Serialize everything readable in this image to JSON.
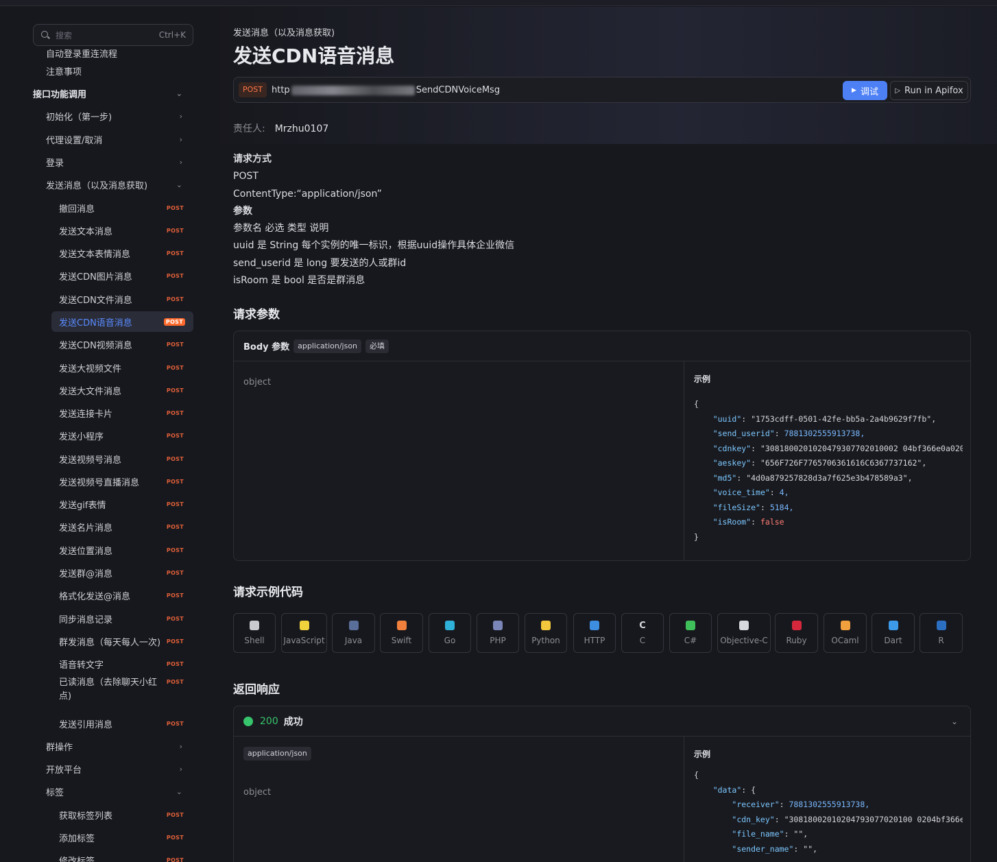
{
  "search": {
    "placeholder": "搜索",
    "shortcut": "Ctrl+K"
  },
  "sidebar": {
    "items": [
      {
        "label": "自动登录重连流程",
        "kind": "leaf-partial"
      },
      {
        "label": "注意事项",
        "kind": "leaf"
      },
      {
        "label": "接口功能调用",
        "kind": "group",
        "chevron": "⌄"
      },
      {
        "label": "初始化（第一步)",
        "kind": "folder",
        "chevron": "›"
      },
      {
        "label": "代理设置/取消",
        "kind": "folder",
        "chevron": "›"
      },
      {
        "label": "登录",
        "kind": "folder",
        "chevron": "›"
      },
      {
        "label": "发送消息（以及消息获取)",
        "kind": "folder",
        "chevron": "⌄"
      },
      {
        "label": "撤回消息",
        "badge": "POST"
      },
      {
        "label": "发送文本消息",
        "badge": "POST"
      },
      {
        "label": "发送文本表情消息",
        "badge": "POST"
      },
      {
        "label": "发送CDN图片消息",
        "badge": "POST"
      },
      {
        "label": "发送CDN文件消息",
        "badge": "POST"
      },
      {
        "label": "发送CDN语音消息",
        "badge": "POST",
        "active": true
      },
      {
        "label": "发送CDN视频消息",
        "badge": "POST"
      },
      {
        "label": "发送大视频文件",
        "badge": "POST"
      },
      {
        "label": "发送大文件消息",
        "badge": "POST"
      },
      {
        "label": "发送连接卡片",
        "badge": "POST"
      },
      {
        "label": "发送小程序",
        "badge": "POST"
      },
      {
        "label": "发送视频号消息",
        "badge": "POST"
      },
      {
        "label": "发送视频号直播消息",
        "badge": "POST"
      },
      {
        "label": "发送gif表情",
        "badge": "POST"
      },
      {
        "label": "发送名片消息",
        "badge": "POST"
      },
      {
        "label": "发送位置消息",
        "badge": "POST"
      },
      {
        "label": "发送群@消息",
        "badge": "POST"
      },
      {
        "label": "格式化发送@消息",
        "badge": "POST"
      },
      {
        "label": "同步消息记录",
        "badge": "POST"
      },
      {
        "label": "群发消息（每天每人一次)",
        "badge": "POST"
      },
      {
        "label": "语音转文字",
        "badge": "POST"
      },
      {
        "label": "已读消息（去除聊天小红",
        "label2": "点)",
        "badge": "POST"
      },
      {
        "label": "发送引用消息",
        "badge": "POST"
      },
      {
        "label": "群操作",
        "kind": "folder",
        "chevron": "›"
      },
      {
        "label": "开放平台",
        "kind": "folder",
        "chevron": "›"
      },
      {
        "label": "标签",
        "kind": "folder",
        "chevron": "⌄"
      },
      {
        "label": "获取标签列表",
        "badge": "POST"
      },
      {
        "label": "添加标签",
        "badge": "POST"
      },
      {
        "label": "修改标签",
        "badge": "POST"
      }
    ]
  },
  "page": {
    "breadcrumb": "发送消息（以及消息获取)",
    "title": "发送CDN语音消息",
    "method": "POST",
    "url_prefix": "http",
    "url_suffix": "SendCDNVoiceMsg",
    "debug_label": "调试",
    "apifox_label": "Run in Apifox",
    "owner_key": "责任人:",
    "owner_value": "Mrzhu0107"
  },
  "description": [
    {
      "text": "请求方式",
      "bold": true
    },
    {
      "text": "POST"
    },
    {
      "text": "ContentType:“application/json”"
    },
    {
      "text": "参数",
      "bold": true
    },
    {
      "text": "参数名 必选 类型 说明"
    },
    {
      "text": "uuid 是 String 每个实例的唯一标识，根据uuid操作具体企业微信"
    },
    {
      "text": "send_userid 是 long 要发送的人或群id"
    },
    {
      "text": "isRoom 是 bool 是否是群消息"
    }
  ],
  "request": {
    "section_title": "请求参数",
    "body_label": "Body 参数",
    "content_type": "application/json",
    "required": "必填",
    "object_label": "object",
    "example_label": "示例",
    "example_lines": [
      "{",
      "    \"uuid\": \"1753cdff-0501-42fe-bb5a-2a4b9629f7fb\",",
      "    \"send_userid\": 7881302555913738,",
      "    \"cdnkey\": \"3081800201020479307702010002 04bf366e0a020",
      "    \"aeskey\": \"656F726F7765706361616C6367737162\",",
      "    \"md5\": \"4d0a879257828d3a7f625e3b478589a3\",",
      "    \"voice_time\": 4,",
      "    \"fileSize\": 5184,",
      "    \"isRoom\": false",
      "}"
    ]
  },
  "code_examples": {
    "section_title": "请求示例代码",
    "languages": [
      "Shell",
      "JavaScript",
      "Java",
      "Swift",
      "Go",
      "PHP",
      "Python",
      "HTTP",
      "C",
      "C#",
      "Objective-C",
      "Ruby",
      "OCaml",
      "Dart",
      "R"
    ]
  },
  "response": {
    "section_title": "返回响应",
    "status_code": "200",
    "status_text": "成功",
    "content_type": "application/json",
    "object_label": "object",
    "example_label": "示例",
    "example_lines": [
      "{",
      "    \"data\": {",
      "        \"receiver\": 7881302555913738,",
      "        \"cdn_key\": \"30818002010204793077020100 0204bf366e",
      "        \"file_name\": \"\",",
      "        \"sender_name\": \"\","
    ]
  },
  "colors": {
    "accent": "#4d80f5",
    "post": "#ff7648",
    "success": "#36c46c"
  }
}
